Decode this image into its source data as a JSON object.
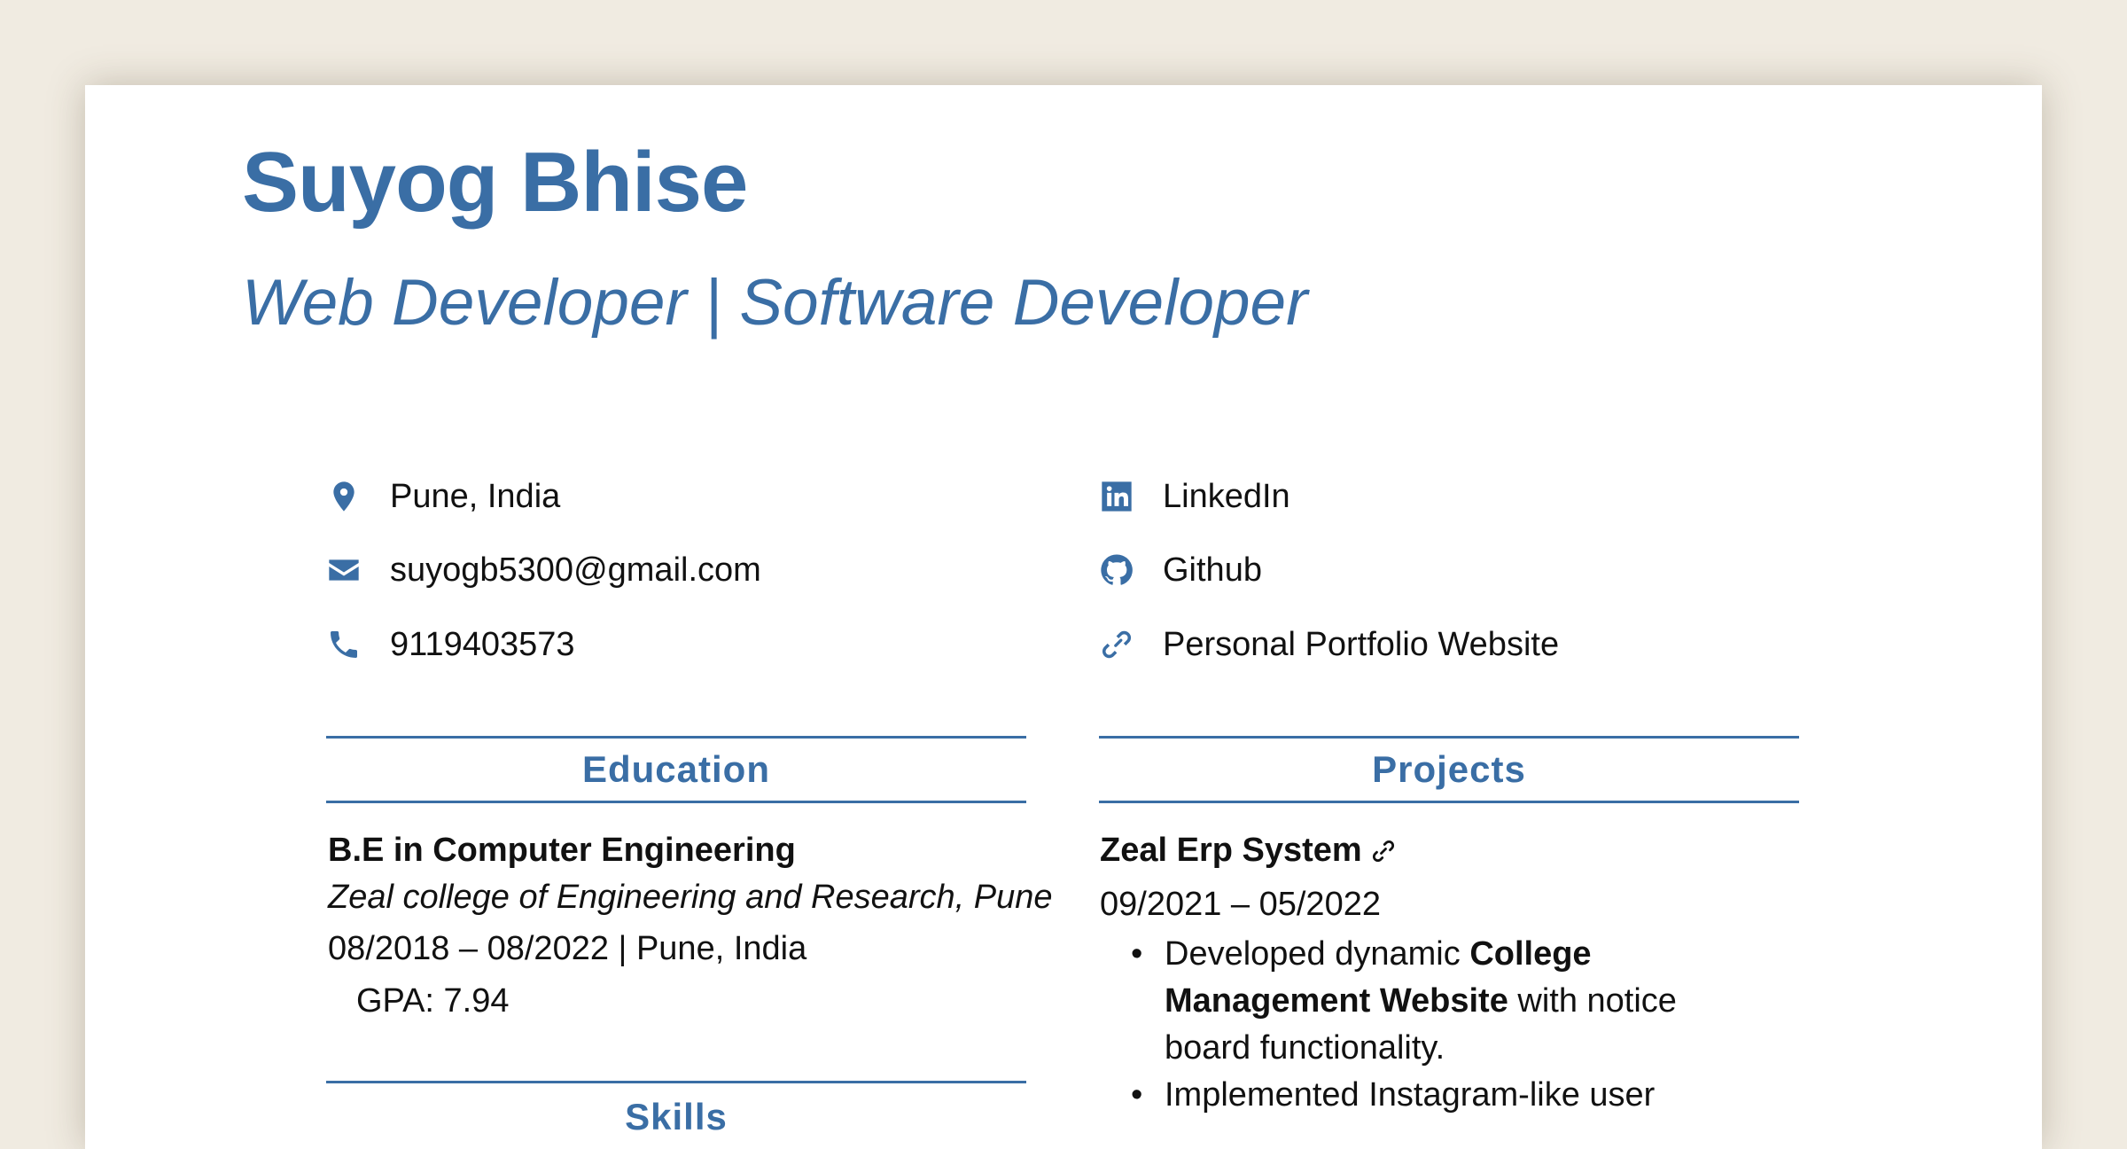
{
  "header": {
    "name": "Suyog Bhise",
    "title": "Web Developer | Software Developer"
  },
  "contact": {
    "location": "Pune, India",
    "email": "suyogb5300@gmail.com",
    "phone": "9119403573",
    "linkedin": "LinkedIn",
    "github": "Github",
    "portfolio": "Personal Portfolio Website"
  },
  "education": {
    "heading": "Education",
    "degree": "B.E in Computer Engineering",
    "school": "Zeal college of Engineering and Research, Pune",
    "dates_location": "08/2018 – 08/2022 | Pune, India",
    "gpa": "GPA: 7.94"
  },
  "skills": {
    "heading": "Skills"
  },
  "projects": {
    "heading": "Projects",
    "items": [
      {
        "name": "Zeal Erp System",
        "dates": "09/2021 – 05/2022",
        "bullets": [
          {
            "pre": "Developed dynamic ",
            "bold": "College Management Website",
            "post": " with notice board functionality."
          },
          {
            "pre": "Implemented Instagram-like user",
            "bold": "",
            "post": ""
          }
        ]
      }
    ]
  },
  "colors": {
    "accent": "#3a6ea5",
    "background": "#f0ebe1",
    "paper": "#ffffff"
  }
}
